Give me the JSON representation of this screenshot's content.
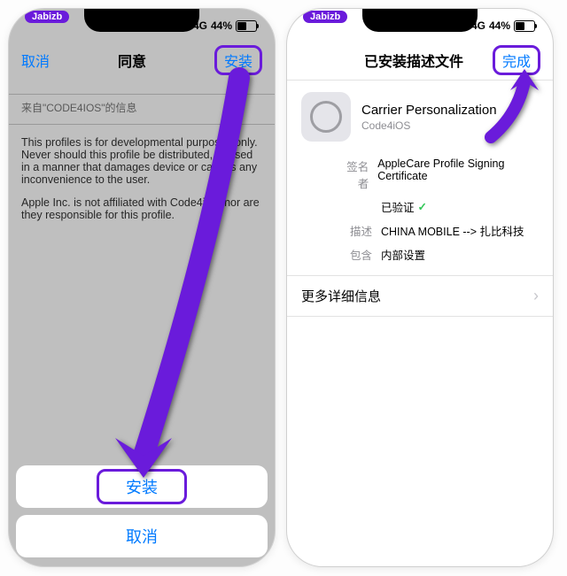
{
  "status": {
    "network": "4G",
    "battery": "44%"
  },
  "watermark": "Jabizb",
  "left_screen": {
    "nav_cancel": "取消",
    "nav_title": "同意",
    "nav_install": "安装",
    "source_label": "来自\"CODE4IOS\"的信息",
    "para1": "This profiles is for developmental purposes only. Never should this profile be distributed, or used in a manner that damages device or causes any inconvenience to the user.",
    "para2": "Apple Inc. is not affiliated with Code4iOS nor are they responsible for this profile.",
    "sheet_install": "安装",
    "sheet_cancel": "取消"
  },
  "right_screen": {
    "nav_title": "已安装描述文件",
    "nav_done": "完成",
    "profile_name": "Carrier Personalization",
    "profile_sub": "Code4iOS",
    "signer_label": "签名者",
    "signer_value": "AppleCare Profile Signing Certificate",
    "verified": "已验证",
    "desc_label": "描述",
    "desc_value": "CHINA MOBILE --> 扎比科技",
    "contains_label": "包含",
    "contains_value": "内部设置",
    "more": "更多详细信息"
  }
}
